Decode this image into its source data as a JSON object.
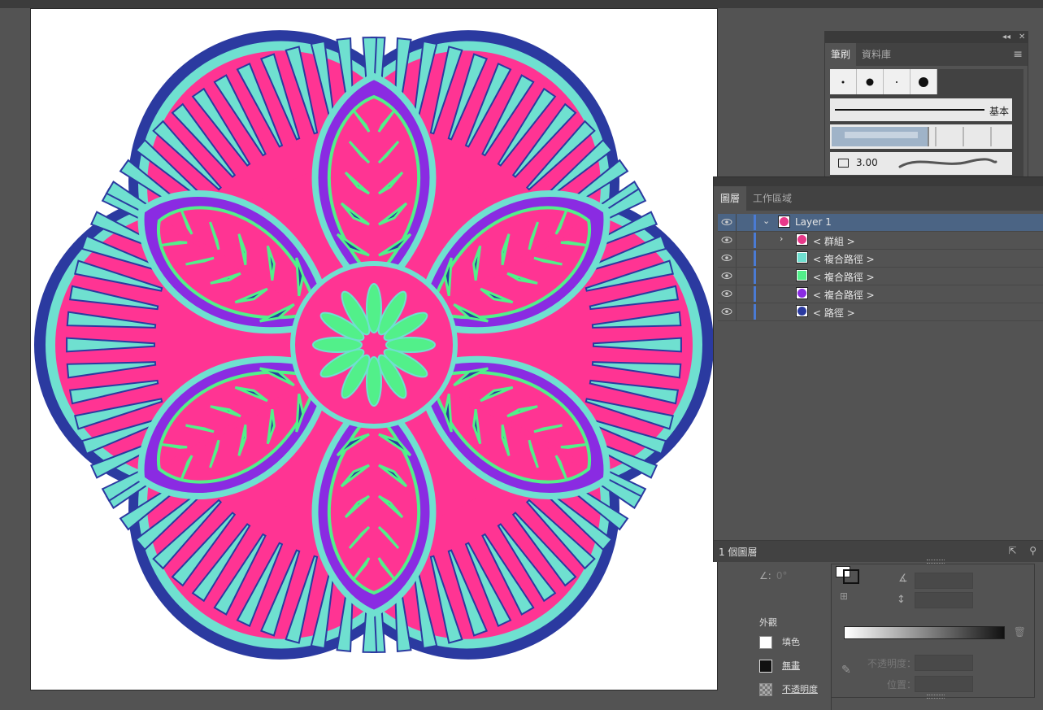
{
  "brushes_panel": {
    "tabs": [
      {
        "label": "筆刷",
        "active": true
      },
      {
        "label": "資料庫",
        "active": false
      }
    ],
    "basic_brush_label": "基本",
    "brush_size_value": "3.00",
    "menu_icon": "hamburger-menu-icon"
  },
  "layers_panel": {
    "tabs": [
      {
        "label": "圖層",
        "active": true
      },
      {
        "label": "工作區域",
        "active": false
      }
    ],
    "rows": [
      {
        "name": "Layer 1",
        "color": "#e8398a",
        "level": 0,
        "expanded": true,
        "selected": true
      },
      {
        "name": "< 群組 >",
        "color": "#e8398a",
        "level": 1,
        "has_children": true
      },
      {
        "name": "< 複合路徑 >",
        "color": "#6fe0d0",
        "level": 1
      },
      {
        "name": "< 複合路徑 >",
        "color": "#52f08a",
        "level": 1
      },
      {
        "name": "< 複合路徑 >",
        "color": "#8a2be2",
        "level": 1
      },
      {
        "name": "< 路徑 >",
        "color": "#2b3aa0",
        "level": 1
      }
    ],
    "footer_count": "1 個圖層"
  },
  "appearance_panel": {
    "angle_value": "0°",
    "title": "外觀",
    "fill_label": "填色",
    "stroke_label": "無畫",
    "opacity_label": "不透明度"
  },
  "gradient_panel": {
    "opacity_label": "不透明度：",
    "position_label": "位置："
  },
  "colors": {
    "mandala_pink": "#ff3493",
    "mandala_aqua": "#6fe0d0",
    "mandala_green": "#52f08a",
    "mandala_purple": "#8a2be2",
    "mandala_navy": "#2b3aa0"
  }
}
